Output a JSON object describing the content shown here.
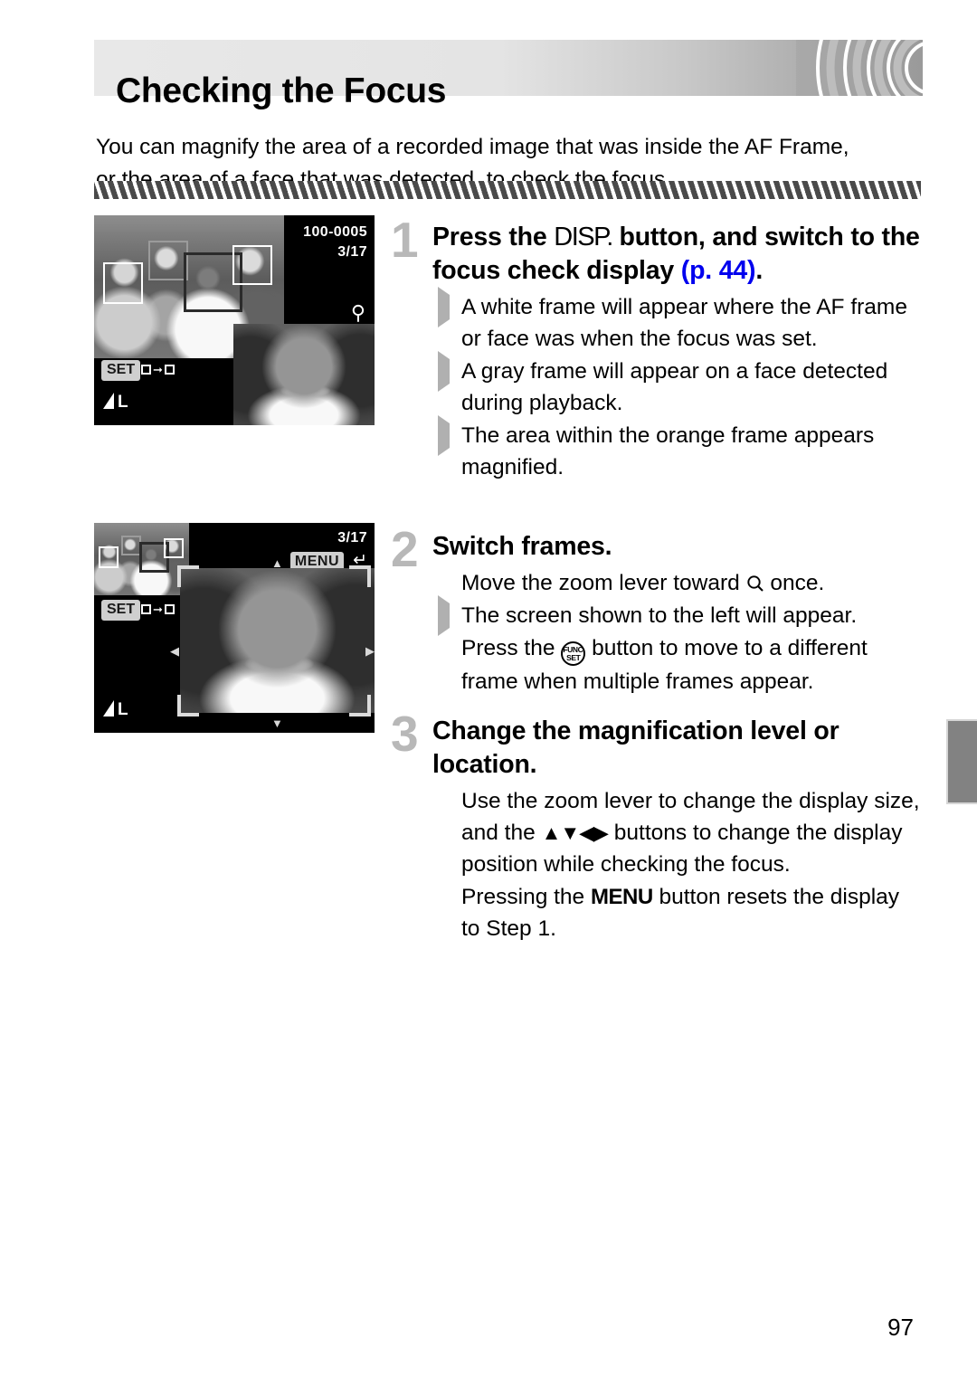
{
  "page": {
    "title": "Checking the Focus",
    "number": "97",
    "intro": "You can magnify the area of a recorded image that was inside the AF Frame, or the area of a face that was detected, to check the focus."
  },
  "screens": [
    {
      "name": "focus-check-display",
      "file_number": "100-0005",
      "frame_counter": "3/17",
      "magnify_icon": "magnifier-icon",
      "set_badge": "SET",
      "set_action_icon": "frame-to-frame-icon",
      "quality_icon": "image-quality-large-fine",
      "quality_label": "L"
    },
    {
      "name": "magnified-focus-check-display",
      "frame_counter": "3/17",
      "menu_badge": "MENU",
      "menu_return_icon": "return-arrow-icon",
      "set_badge": "SET",
      "set_action_icon": "frame-to-frame-icon",
      "quality_icon": "image-quality-large-fine",
      "quality_label": "L"
    }
  ],
  "steps": [
    {
      "number": "1",
      "heading_parts": {
        "before": "Press the ",
        "icon": "DISP.",
        "middle": " button, and switch to the focus check display ",
        "link": "(p. 44)",
        "after": "."
      },
      "bullets": [
        {
          "mark": "triangle",
          "text": "A white frame will appear where the AF frame or face was when the focus was set."
        },
        {
          "mark": "triangle",
          "text": "A gray frame will appear on a face detected during playback."
        },
        {
          "mark": "triangle",
          "text": "The area within the orange frame appears magnified."
        }
      ]
    },
    {
      "number": "2",
      "heading": "Switch frames.",
      "bullets": [
        {
          "mark": "dot",
          "before": "Move the zoom lever toward ",
          "icon": "magnifier-icon",
          "after": " once."
        },
        {
          "mark": "triangle",
          "text": "The screen shown to the left will appear."
        },
        {
          "mark": "dot",
          "before": "Press the ",
          "icon": "func-set-button",
          "after": " button to move to a different frame when multiple frames appear."
        }
      ]
    },
    {
      "number": "3",
      "heading": "Change the magnification level or location.",
      "bullets": [
        {
          "mark": "dot",
          "before": "Use the zoom lever to change the display size, and the ",
          "icon": "up-down-left-right-buttons",
          "after": " buttons to change the display position while checking the focus."
        },
        {
          "mark": "dot",
          "before": "Pressing the ",
          "icon": "MENU",
          "after": " button resets the display to Step 1."
        }
      ]
    }
  ],
  "colors": {
    "link": "#0000ee",
    "step_number": "#b8b8b8",
    "bullet": "#bdbdbd",
    "header_band_light": "#e8e8e8",
    "header_band_dark": "#a9a9a9",
    "side_tab": "#828282"
  }
}
